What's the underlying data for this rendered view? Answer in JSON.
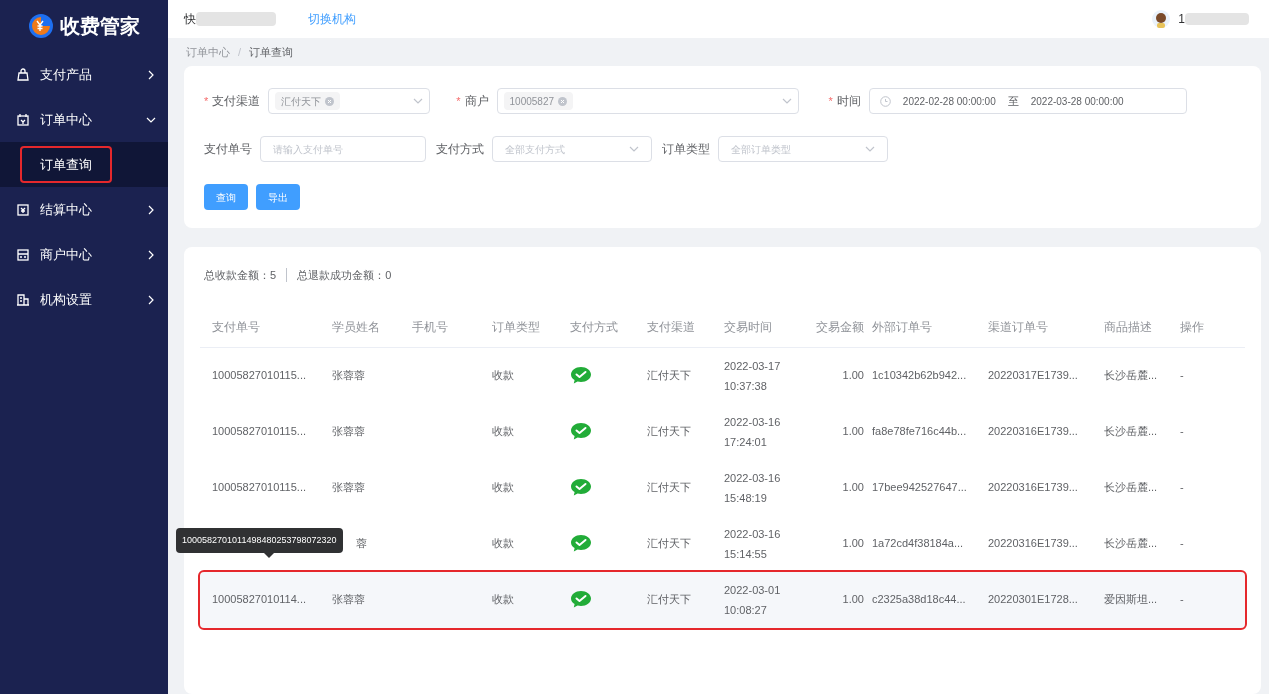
{
  "logo": {
    "text": "收费管家"
  },
  "header": {
    "org_name": "快",
    "switch_link": "切换机构",
    "user_name": "1"
  },
  "sidebar": {
    "items": [
      {
        "label": "支付产品",
        "kind": "bag",
        "expanded": false
      },
      {
        "label": "订单中心",
        "kind": "order",
        "expanded": true,
        "children": [
          {
            "label": "订单查询",
            "selected": true
          }
        ]
      },
      {
        "label": "结算中心",
        "kind": "settle",
        "expanded": false
      },
      {
        "label": "商户中心",
        "kind": "shop",
        "expanded": false
      },
      {
        "label": "机构设置",
        "kind": "org",
        "expanded": false
      }
    ]
  },
  "breadcrumb": {
    "items": [
      "订单中心",
      "订单查询"
    ],
    "separator": "/"
  },
  "filters": [
    [
      {
        "label": "支付渠道",
        "required_mark": "*",
        "kind": "tags",
        "tag": "汇付天下"
      },
      {
        "label": "商户",
        "required_mark": "*",
        "kind": "tags",
        "tag": "10005827"
      },
      {
        "label": "时间",
        "required_mark": "*",
        "kind": "date",
        "start": "2022-02-28 00:00:00",
        "separator": "至",
        "end": "2022-03-28 00:00:00"
      }
    ],
    [
      {
        "label": "支付单号",
        "kind": "input",
        "placeholder": "请输入支付单号"
      },
      {
        "label": "支付方式",
        "kind": "select",
        "placeholder": "全部支付方式"
      },
      {
        "label": "订单类型",
        "kind": "select",
        "placeholder": "全部订单类型"
      }
    ]
  ],
  "buttons": [
    "查询",
    "导出"
  ],
  "summary": {
    "total_label": "总收款金额：5",
    "refund_label": "总退款成功金额：0"
  },
  "table": {
    "columns": [
      "支付单号",
      "学员姓名",
      "手机号",
      "订单类型",
      "支付方式",
      "支付渠道",
      "交易时间",
      "交易金额",
      "外部订单号",
      "渠道订单号",
      "商品描述",
      "操作"
    ],
    "rows": [
      {
        "pay_no": "10005827010115...",
        "name": "张蓉蓉",
        "type": "收款",
        "kind": "wechat",
        "channel": "汇付天下",
        "date": "2022-03-17",
        "time": "10:37:38",
        "amount": "1.00",
        "ext_no": "1c10342b62b942...",
        "channel_no": "20220317E1739...",
        "desc": "长沙岳麓...",
        "op": "-",
        "highlighted": false
      },
      {
        "pay_no": "10005827010115...",
        "name": "张蓉蓉",
        "type": "收款",
        "kind": "wechat",
        "channel": "汇付天下",
        "date": "2022-03-16",
        "time": "17:24:01",
        "amount": "1.00",
        "ext_no": "fa8e78fe716c44b...",
        "channel_no": "20220316E1739...",
        "desc": "长沙岳麓...",
        "op": "-",
        "highlighted": false
      },
      {
        "pay_no": "10005827010115...",
        "name": "张蓉蓉",
        "type": "收款",
        "kind": "wechat",
        "channel": "汇付天下",
        "date": "2022-03-16",
        "time": "15:48:19",
        "amount": "1.00",
        "ext_no": "17bee942527647...",
        "channel_no": "20220316E1739...",
        "desc": "长沙岳麓...",
        "op": "-",
        "highlighted": false
      },
      {
        "name": "蓉",
        "type": "收款",
        "kind": "wechat",
        "channel": "汇付天下",
        "date": "2022-03-16",
        "time": "15:14:55",
        "amount": "1.00",
        "ext_no": "1a72cd4f38184a...",
        "channel_no": "20220316E1739...",
        "desc": "长沙岳麓...",
        "op": "-",
        "highlighted": false,
        "tooltip": "1000582701011498480253798072320"
      },
      {
        "pay_no": "10005827010114...",
        "name": "张蓉蓉",
        "type": "收款",
        "kind": "wechat",
        "channel": "汇付天下",
        "date": "2022-03-01",
        "time": "10:08:27",
        "amount": "1.00",
        "ext_no": "c2325a38d18c44...",
        "channel_no": "20220301E1728...",
        "desc": "爱因斯坦...",
        "op": "-",
        "highlighted": true
      }
    ]
  }
}
